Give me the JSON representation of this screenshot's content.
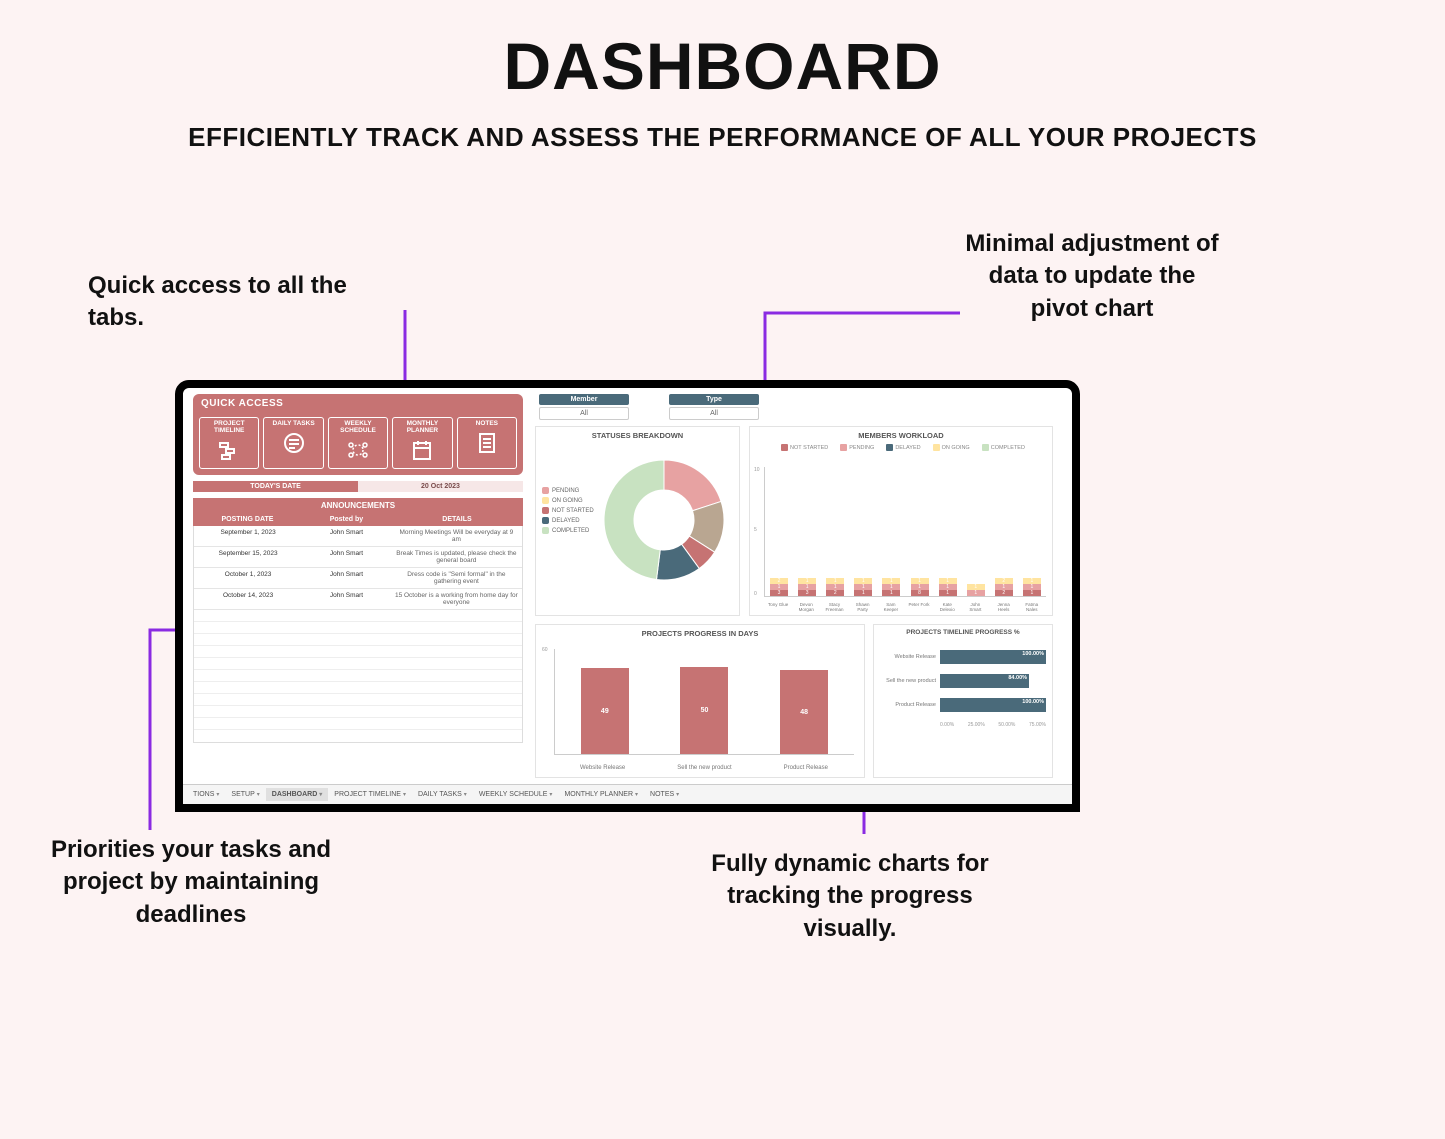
{
  "page": {
    "title": "DASHBOARD",
    "subtitle": "EFFICIENTLY TRACK AND ASSESS THE PERFORMANCE OF ALL YOUR PROJECTS"
  },
  "annotations": {
    "tl": "Quick access to all the tabs.",
    "tr": "Minimal adjustment of data to update the pivot chart",
    "bl": "Priorities your tasks and project by maintaining deadlines",
    "br": "Fully dynamic charts for tracking the progress visually."
  },
  "quick_access": {
    "title": "QUICK ACCESS",
    "tiles": [
      {
        "label": "PROJECT TIMELINE"
      },
      {
        "label": "DAILY TASKS"
      },
      {
        "label": "WEEKLY SCHEDULE"
      },
      {
        "label": "MONTHLY PLANNER"
      },
      {
        "label": "NOTES"
      }
    ],
    "today_label": "TODAY'S DATE",
    "today_value": "20 Oct 2023"
  },
  "announcements": {
    "title": "ANNOUNCEMENTS",
    "headers": {
      "c1": "POSTING DATE",
      "c2": "Posted by",
      "c3": "DETAILS"
    },
    "rows": [
      {
        "date": "September 1, 2023",
        "by": "John Smart",
        "details": "Morning Meetings Will be everyday at 9 am"
      },
      {
        "date": "September 15, 2023",
        "by": "John Smart",
        "details": "Break Times is updated, please check the general board"
      },
      {
        "date": "October 1, 2023",
        "by": "John Smart",
        "details": "Dress code is \"Semi formal\" in the gathering event"
      },
      {
        "date": "October 14, 2023",
        "by": "John Smart",
        "details": "15 October is a working from home day for everyone"
      }
    ]
  },
  "filters": {
    "member": {
      "label": "Member",
      "value": "All"
    },
    "type": {
      "label": "Type",
      "value": "All"
    }
  },
  "statuses": {
    "title": "STATUSES BREAKDOWN",
    "legend": [
      {
        "label": "PENDING",
        "color": "#e7a2a2"
      },
      {
        "label": "ON GOING",
        "color": "#ffe4a0"
      },
      {
        "label": "NOT STARTED",
        "color": "#c67373"
      },
      {
        "label": "DELAYED",
        "color": "#4a6a7a"
      },
      {
        "label": "COMPLETED",
        "color": "#c8e2c1"
      }
    ]
  },
  "workload": {
    "title": "MEMBERS WORKLOAD",
    "legend": [
      {
        "label": "NOT STARTED",
        "color": "#c67373"
      },
      {
        "label": "PENDING",
        "color": "#e7a2a2"
      },
      {
        "label": "DELAYED",
        "color": "#4a6a7a"
      },
      {
        "label": "ON GOING",
        "color": "#ffe4a0"
      },
      {
        "label": "COMPLETED",
        "color": "#c8e2c1"
      }
    ],
    "ylim": 10,
    "y_ticks": [
      "0",
      "5",
      "10"
    ],
    "members": [
      "Tony Glue",
      "Devon Morgan",
      "Stacy Freeman",
      "Shawn Party",
      "Sam Keeper",
      "Peter Fork",
      "Kate Delexio",
      "John Smart",
      "Jenna Heels",
      "Fatma Nales"
    ]
  },
  "progress_days": {
    "title": "PROJECTS PROGRESS IN DAYS",
    "ylim": 60,
    "y_tick": "60"
  },
  "timeline_pct": {
    "title": "PROJECTS TIMELINE PROGRESS %",
    "x_ticks": [
      "0.00%",
      "25.00%",
      "50.00%",
      "75.00%"
    ]
  },
  "chart_data": [
    {
      "id": "statuses_breakdown",
      "type": "pie",
      "title": "STATUSES BREAKDOWN",
      "series": [
        {
          "name": "PENDING",
          "value": 20,
          "color": "#e7a2a2"
        },
        {
          "name": "ON GOING",
          "value": 14,
          "color": "#b9a691"
        },
        {
          "name": "NOT STARTED",
          "value": 6,
          "color": "#c67373"
        },
        {
          "name": "DELAYED",
          "value": 12,
          "color": "#4a6a7a"
        },
        {
          "name": "COMPLETED",
          "value": 48,
          "color": "#c8e2c1"
        }
      ]
    },
    {
      "id": "members_workload",
      "type": "bar",
      "stacked": true,
      "title": "MEMBERS WORKLOAD",
      "ylim": [
        0,
        10
      ],
      "categories": [
        "Tony Glue",
        "Devon Morgan",
        "Stacy Freeman",
        "Shawn Party",
        "Sam Keeper",
        "Peter Fork",
        "Kate Delexio",
        "John Smart",
        "Jenna Heels",
        "Fatma Nales"
      ],
      "series": [
        {
          "name": "NOT STARTED",
          "color": "#c67373",
          "values": [
            3,
            3,
            2,
            1,
            1,
            8,
            1,
            0,
            2,
            1
          ]
        },
        {
          "name": "PENDING",
          "color": "#e7a2a2",
          "values": [
            1,
            1,
            1,
            1,
            1,
            1,
            1,
            1,
            1,
            1
          ]
        },
        {
          "name": "DELAYED",
          "color": "#4a6a7a",
          "values": [
            0,
            0,
            0,
            0,
            0,
            0,
            0,
            0,
            0,
            0
          ]
        },
        {
          "name": "ON GOING",
          "color": "#ffe4a0",
          "values": [
            2,
            1,
            1,
            1,
            1,
            1,
            1,
            1,
            2,
            1
          ]
        },
        {
          "name": "COMPLETED",
          "color": "#c8e2c1",
          "values": [
            0,
            0,
            0,
            0,
            0,
            0,
            0,
            0,
            0,
            0
          ]
        }
      ]
    },
    {
      "id": "projects_progress_days",
      "type": "bar",
      "title": "PROJECTS PROGRESS IN DAYS",
      "ylim": [
        0,
        60
      ],
      "categories": [
        "Website Release",
        "Sell the new product",
        "Product Release"
      ],
      "values": [
        49,
        50,
        48
      ]
    },
    {
      "id": "projects_timeline_progress_pct",
      "type": "bar",
      "orientation": "horizontal",
      "title": "PROJECTS TIMELINE PROGRESS %",
      "xlim": [
        0,
        100
      ],
      "categories": [
        "Website Release",
        "Sell the new product",
        "Product Release"
      ],
      "values": [
        100.0,
        84.0,
        100.0
      ],
      "labels": [
        "100.00%",
        "84.00%",
        "100.00%"
      ]
    }
  ],
  "sheet_tabs": [
    {
      "label": "TIONS",
      "active": false
    },
    {
      "label": "SETUP",
      "active": false
    },
    {
      "label": "DASHBOARD",
      "active": true
    },
    {
      "label": "PROJECT TIMELINE",
      "active": false
    },
    {
      "label": "DAILY TASKS",
      "active": false
    },
    {
      "label": "WEEKLY SCHEDULE",
      "active": false
    },
    {
      "label": "MONTHLY PLANNER",
      "active": false
    },
    {
      "label": "NOTES",
      "active": false
    }
  ]
}
